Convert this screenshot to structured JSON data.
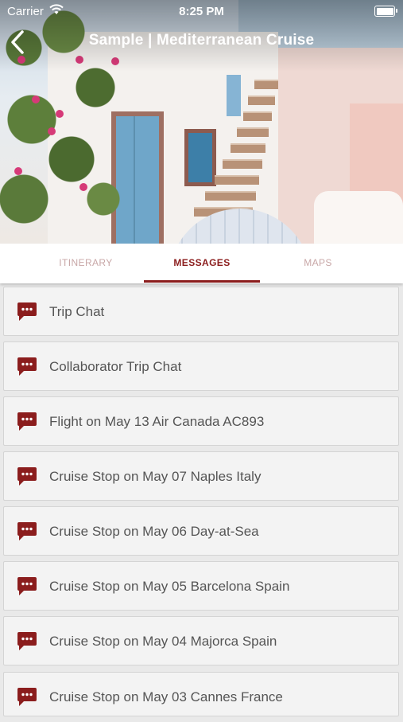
{
  "status_bar": {
    "carrier": "Carrier",
    "time": "8:25 PM"
  },
  "header": {
    "title": "Sample | Mediterranean Cruise"
  },
  "tabs": [
    {
      "label": "ITINERARY",
      "active": false
    },
    {
      "label": "MESSAGES",
      "active": true
    },
    {
      "label": "MAPS",
      "active": false
    }
  ],
  "messages": [
    {
      "label": "Trip Chat",
      "icon": "chat-bubble-icon"
    },
    {
      "label": "Collaborator Trip Chat",
      "icon": "chat-bubble-icon"
    },
    {
      "label": "Flight on May 13 Air Canada AC893",
      "icon": "chat-bubble-icon"
    },
    {
      "label": "Cruise Stop on May 07 Naples Italy",
      "icon": "chat-bubble-icon"
    },
    {
      "label": "Cruise Stop on May 06 Day-at-Sea",
      "icon": "chat-bubble-icon"
    },
    {
      "label": "Cruise Stop on May 05 Barcelona Spain",
      "icon": "chat-bubble-icon"
    },
    {
      "label": "Cruise Stop on May 04 Majorca Spain",
      "icon": "chat-bubble-icon"
    },
    {
      "label": "Cruise Stop on May 03 Cannes France",
      "icon": "chat-bubble-icon"
    }
  ],
  "colors": {
    "accent": "#8b1d1d",
    "tab_inactive": "#c8a7a7",
    "row_bg": "#f3f3f3"
  }
}
